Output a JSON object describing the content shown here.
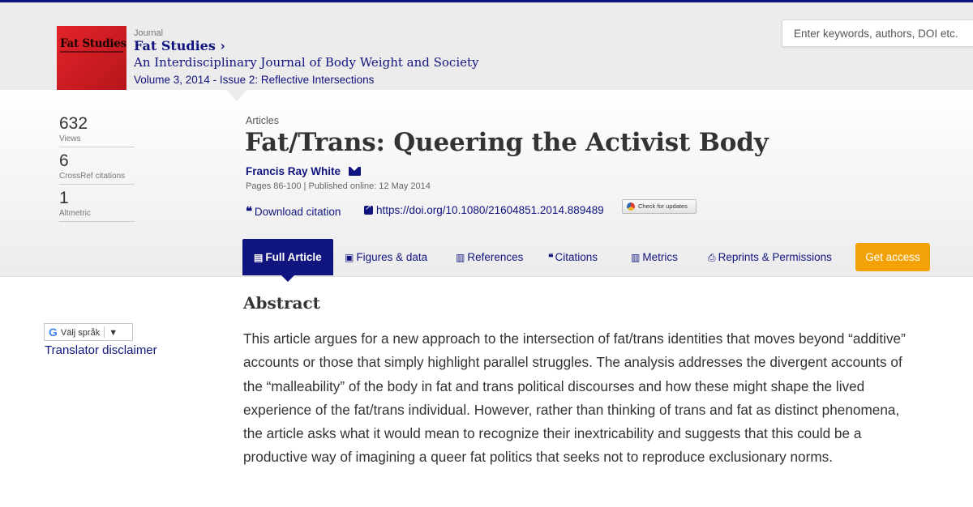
{
  "header": {
    "journal_label": "Journal",
    "journal_name": "Fat Studies",
    "journal_name_suffix": "›",
    "journal_subtitle": "An Interdisciplinary Journal of Body Weight and Society",
    "volume_issue": "Volume 3, 2014 - Issue 2: Reflective Intersections",
    "cover_text": "Fat Studies",
    "search_placeholder": "Enter keywords, authors, DOI etc."
  },
  "metrics": [
    {
      "value": "632",
      "label": "Views"
    },
    {
      "value": "6",
      "label": "CrossRef citations"
    },
    {
      "value": "1",
      "label": "Altmetric"
    }
  ],
  "article": {
    "section": "Articles",
    "title": "Fat/Trans: Queering the Activist Body",
    "author": "Francis Ray White",
    "pub_info": "Pages 86-100 | Published online: 12 May 2014",
    "download_citation": "Download citation",
    "doi": "https://doi.org/10.1080/21604851.2014.889489",
    "check_updates": "Check for updates"
  },
  "tabs": [
    {
      "label": "Full Article",
      "icon": "document-icon"
    },
    {
      "label": "Figures & data",
      "icon": "image-icon"
    },
    {
      "label": "References",
      "icon": "book-icon"
    },
    {
      "label": "Citations",
      "icon": "quote-icon"
    },
    {
      "label": "Metrics",
      "icon": "bar-chart-icon"
    },
    {
      "label": "Reprints & Permissions",
      "icon": "printer-icon"
    }
  ],
  "get_access": "Get access",
  "translate": {
    "select_label": "Välj språk",
    "disclaimer": "Translator disclaimer"
  },
  "abstract": {
    "heading": "Abstract",
    "text": "This article argues for a new approach to the intersection of fat/trans identities that moves beyond “additive” accounts or those that simply highlight parallel struggles. The analysis addresses the divergent accounts of the “malleability” of the body in fat and trans political discourses and how these might shape the lived experience of the fat/trans individual. However, rather than thinking of trans and fat as distinct phenomena, the article asks what it would mean to recognize their inextricability and suggests that this could be a productive way of imagining a queer fat politics that seeks not to reproduce exclusionary norms."
  },
  "colors": {
    "brand_navy": "#10147e",
    "access_orange": "#f2a207",
    "cover_red": "#d41f26"
  }
}
